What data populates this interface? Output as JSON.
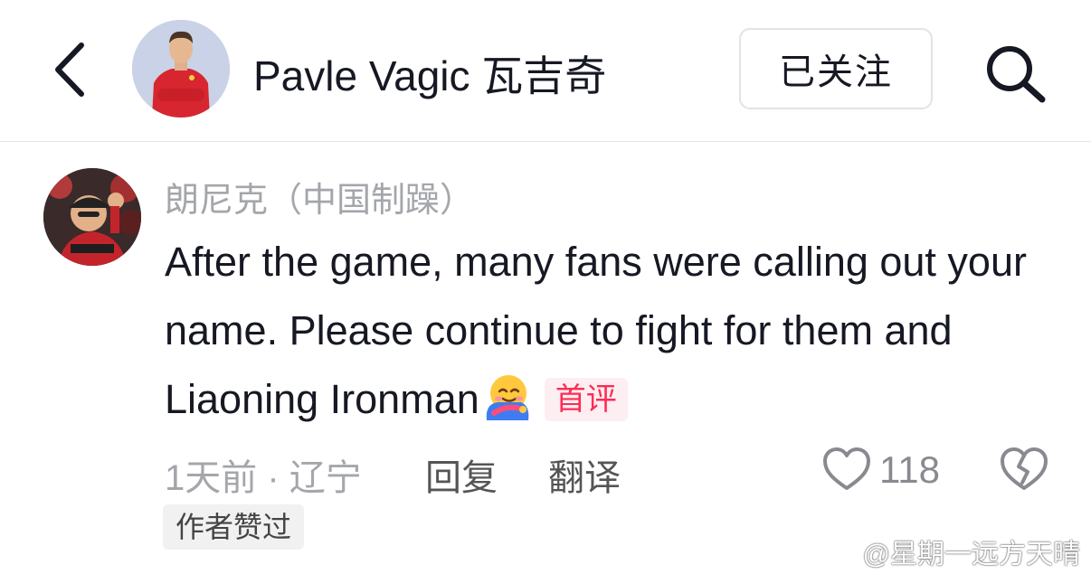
{
  "header": {
    "back_icon": "chevron-left-icon",
    "name": "Pavle Vagic 瓦吉奇",
    "follow_label": "已关注",
    "search_icon": "search-icon"
  },
  "comment": {
    "username": "朗尼克（中国制躁）",
    "text": "After the game, many fans were calling out your name. Please continue to fight for them and Liaoning Ironman",
    "emoji": "smiling-face-with-hug-emoji",
    "first_badge": "首评",
    "time_location": "1天前 · 辽宁",
    "reply_label": "回复",
    "translate_label": "翻译",
    "like_count": "118",
    "author_liked": "作者赞过"
  },
  "watermark": {
    "text": "@星期一远方天晴",
    "icon": "weibo-icon"
  },
  "colors": {
    "accent": "#fe2c55",
    "muted_text": "#a4a6ab",
    "primary_text": "#161823"
  }
}
